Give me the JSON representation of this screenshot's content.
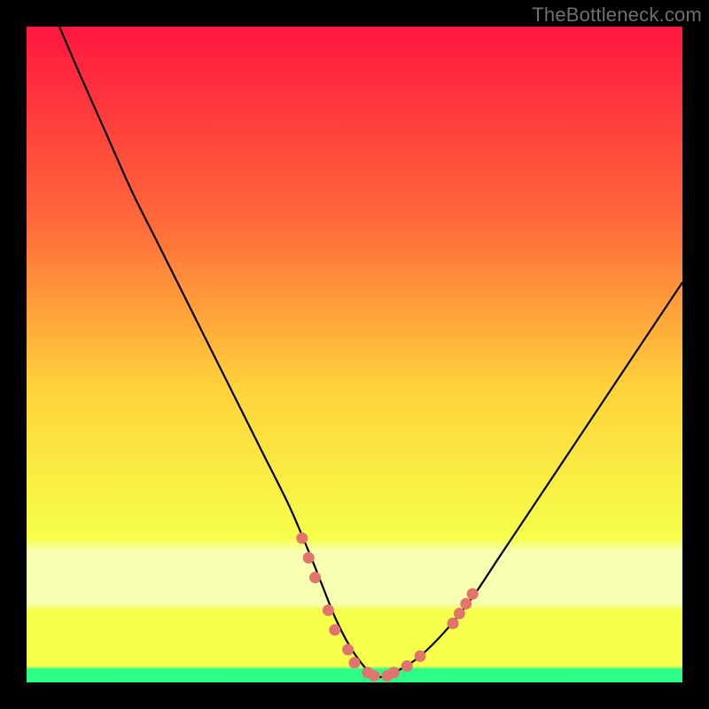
{
  "watermark": "TheBottleneck.com",
  "colors": {
    "gradient_top": "#ff163f",
    "gradient_mid_upper": "#ff6a3a",
    "gradient_mid": "#ffd23a",
    "gradient_lower": "#f6ff4a",
    "gradient_band": "#f8ffb0",
    "gradient_bottom": "#2dfc87",
    "curve": "#000000",
    "markers": "#e1756e",
    "frame": "#000000"
  },
  "chart_data": {
    "type": "line",
    "title": "",
    "xlabel": "",
    "ylabel": "",
    "xlim": [
      0,
      100
    ],
    "ylim": [
      0,
      100
    ],
    "grid": false,
    "legend": false,
    "series": [
      {
        "name": "bottleneck-curve",
        "x": [
          5,
          8,
          12,
          16,
          20,
          24,
          28,
          32,
          36,
          40,
          43,
          45,
          47,
          49,
          51,
          53,
          55,
          57,
          60,
          64,
          68,
          72,
          76,
          80,
          84,
          88,
          92,
          96,
          100
        ],
        "y": [
          100,
          93,
          84,
          75,
          67,
          59,
          51,
          43,
          35,
          27,
          20,
          15,
          10,
          6,
          3,
          1,
          1,
          2,
          4,
          8,
          13,
          19,
          25,
          31,
          37,
          43,
          49,
          55,
          61
        ]
      }
    ],
    "markers": {
      "name": "highlight-points",
      "points": [
        {
          "x": 42,
          "y": 22
        },
        {
          "x": 43,
          "y": 19
        },
        {
          "x": 44,
          "y": 16
        },
        {
          "x": 46,
          "y": 11
        },
        {
          "x": 47,
          "y": 8
        },
        {
          "x": 49,
          "y": 5
        },
        {
          "x": 50,
          "y": 3
        },
        {
          "x": 52,
          "y": 1.5
        },
        {
          "x": 53,
          "y": 1
        },
        {
          "x": 55,
          "y": 1
        },
        {
          "x": 56,
          "y": 1.5
        },
        {
          "x": 58,
          "y": 2.5
        },
        {
          "x": 60,
          "y": 4
        },
        {
          "x": 65,
          "y": 9
        },
        {
          "x": 66,
          "y": 10.5
        },
        {
          "x": 67,
          "y": 12
        },
        {
          "x": 68,
          "y": 13.5
        }
      ]
    }
  }
}
